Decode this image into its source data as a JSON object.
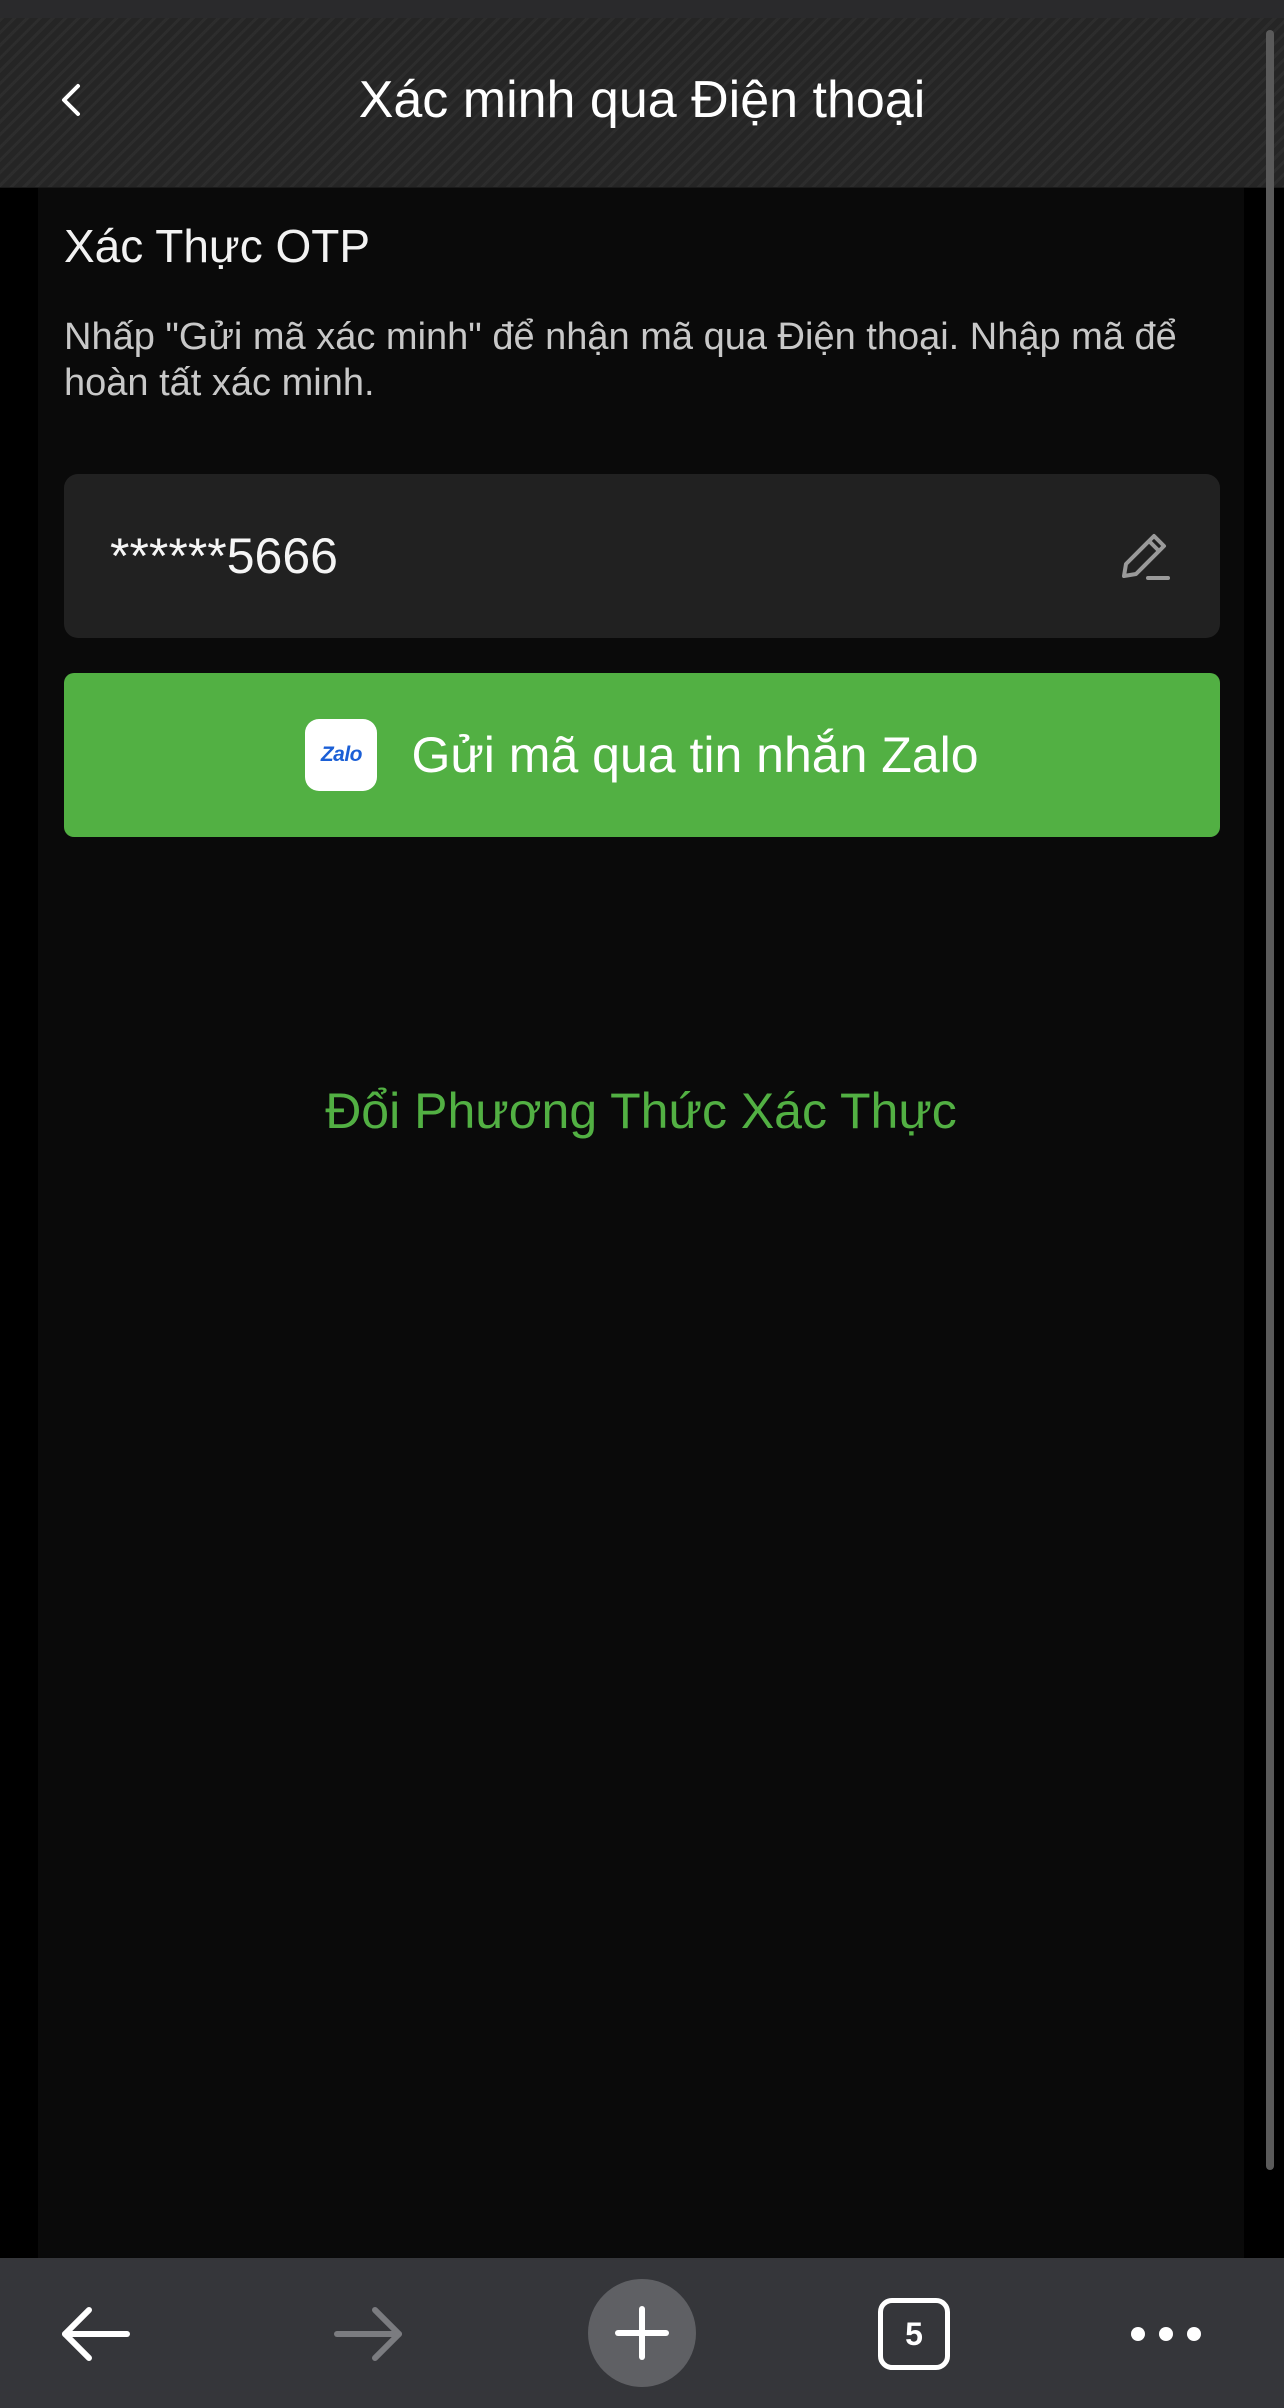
{
  "header": {
    "title": "Xác minh qua Điện thoại",
    "back_icon": "chevron-left-icon"
  },
  "otp": {
    "section_title": "Xác Thực OTP",
    "description": "Nhấp \"Gửi mã xác minh\" để nhận mã qua Điện thoại. Nhập mã để hoàn tất xác minh.",
    "phone_masked": "******5666",
    "edit_icon": "pencil-icon"
  },
  "send_button": {
    "logo_text": "Zalo",
    "label": "Gửi mã qua tin nhắn Zalo",
    "color": "#52b043"
  },
  "change_method": {
    "label": "Đổi Phương Thức Xác Thực",
    "color": "#52b043"
  },
  "browser_toolbar": {
    "back_icon": "arrow-left-icon",
    "forward_icon": "arrow-right-icon",
    "new_tab_icon": "plus-icon",
    "tab_count": "5",
    "menu_icon": "more-dots-icon"
  }
}
